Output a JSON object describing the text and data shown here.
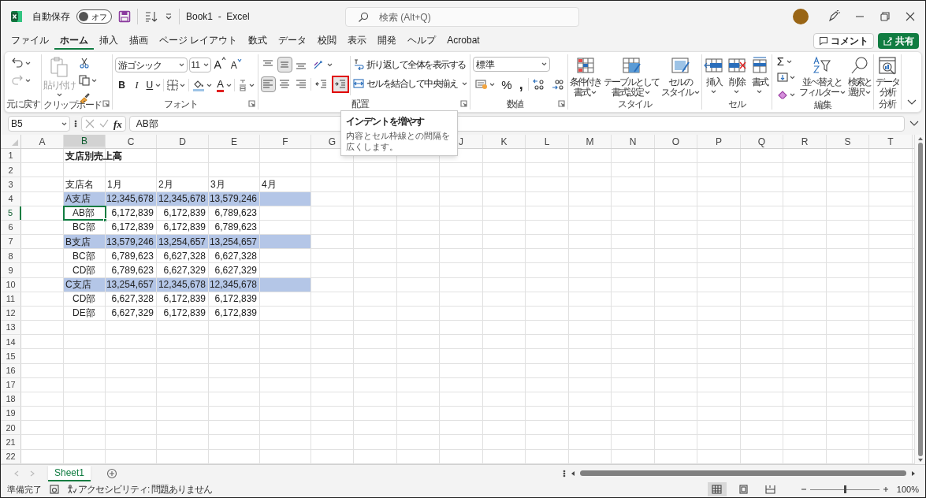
{
  "window": {
    "title": "Book1  -  Excel",
    "autosave_label": "自動保存",
    "autosave_state": "オフ",
    "autosave_on": false,
    "search_placeholder": "検索 (Alt+Q)"
  },
  "menu_tabs": [
    {
      "label": "ファイル",
      "selected": false
    },
    {
      "label": "ホーム",
      "selected": true
    },
    {
      "label": "挿入",
      "selected": false
    },
    {
      "label": "描画",
      "selected": false
    },
    {
      "label": "ページ レイアウト",
      "selected": false
    },
    {
      "label": "数式",
      "selected": false
    },
    {
      "label": "データ",
      "selected": false
    },
    {
      "label": "校閲",
      "selected": false
    },
    {
      "label": "表示",
      "selected": false
    },
    {
      "label": "開発",
      "selected": false
    },
    {
      "label": "ヘルプ",
      "selected": false
    },
    {
      "label": "Acrobat",
      "selected": false
    }
  ],
  "comment_button": "コメント",
  "share_button": "共有",
  "ribbon": {
    "undo": {
      "label": "元に戻す",
      "redo_disabled": true
    },
    "clipboard": {
      "label": "クリップボード",
      "paste": {
        "label": "貼り付け",
        "disabled": true
      }
    },
    "font": {
      "label": "フォント",
      "font_name": "游ゴシック",
      "font_size": "11",
      "grow": "A",
      "shrink": "A",
      "bold": "B",
      "italic": "I",
      "underline": "U",
      "font_color": "A"
    },
    "alignment": {
      "label": "配置",
      "vertical": [
        {
          "kind": "top",
          "selected": false
        },
        {
          "kind": "middle",
          "selected": true
        },
        {
          "kind": "bottom",
          "selected": false
        }
      ],
      "horizontal": [
        {
          "kind": "left",
          "selected": true
        },
        {
          "kind": "center",
          "selected": false
        },
        {
          "kind": "right",
          "selected": false
        }
      ],
      "indent": [
        {
          "kind": "decrease",
          "highlighted": false
        },
        {
          "kind": "increase",
          "highlighted": true
        }
      ],
      "wrap_text": "折り返して全体を表示する",
      "merge": "セルを結合して中央揃え"
    },
    "number": {
      "label": "数値",
      "format": "標準",
      "percent": "%",
      "comma": ","
    },
    "styles": {
      "label": "スタイル",
      "buttons": [
        {
          "kind": "conditional",
          "lines": [
            "条件付き",
            "書式"
          ],
          "dropdown": true
        },
        {
          "kind": "table",
          "lines": [
            "テーブルとして",
            "書式設定"
          ],
          "dropdown": true
        },
        {
          "kind": "cell_style",
          "lines": [
            "セルの",
            "スタイル"
          ],
          "dropdown": true
        }
      ]
    },
    "cells": {
      "label": "セル",
      "buttons": [
        {
          "kind": "insert",
          "lines": [
            "挿入"
          ],
          "dropdown": true
        },
        {
          "kind": "delete",
          "lines": [
            "削除"
          ],
          "dropdown": true
        },
        {
          "kind": "format",
          "lines": [
            "書式"
          ],
          "dropdown": true
        }
      ]
    },
    "editing": {
      "label": "編集",
      "autosum": "Σ",
      "buttons": [
        {
          "kind": "sort",
          "lines": [
            "並べ替えと",
            "フィルター"
          ],
          "dropdown": true
        },
        {
          "kind": "find",
          "lines": [
            "検索と",
            "選択"
          ],
          "dropdown": true
        }
      ]
    },
    "analysis": {
      "label": "分析",
      "buttons": [
        {
          "kind": "analyze",
          "lines": [
            "データ",
            "分析"
          ],
          "dropdown": false
        }
      ]
    }
  },
  "formula_bar": {
    "name_box": "B5",
    "fx": "fx",
    "content": "AB部"
  },
  "tooltip": {
    "title": "インデントを増やす",
    "body": "内容とセル枠線との間隔を広くします。"
  },
  "columns": [
    {
      "label": "A",
      "selected": false
    },
    {
      "label": "B",
      "selected": true
    },
    {
      "label": "C",
      "selected": false
    },
    {
      "label": "D",
      "selected": false
    },
    {
      "label": "E",
      "selected": false
    },
    {
      "label": "F",
      "selected": false
    },
    {
      "label": "G",
      "selected": false
    }
  ],
  "columns_right": [
    {
      "label": "J",
      "selected": false
    },
    {
      "label": "K",
      "selected": false
    },
    {
      "label": "L",
      "selected": false
    },
    {
      "label": "M",
      "selected": false
    },
    {
      "label": "N",
      "selected": false
    },
    {
      "label": "O",
      "selected": false
    },
    {
      "label": "P",
      "selected": false
    },
    {
      "label": "Q",
      "selected": false
    },
    {
      "label": "R",
      "selected": false
    },
    {
      "label": "S",
      "selected": false
    },
    {
      "label": "T",
      "selected": false
    }
  ],
  "rows": [
    {
      "number": "1",
      "selected": false,
      "highlighted": false,
      "cells": [
        {
          "text": "支店別売上高",
          "kind": "title"
        }
      ]
    },
    {
      "number": "2",
      "selected": false,
      "highlighted": false
    },
    {
      "number": "3",
      "selected": false,
      "highlighted": false,
      "cells": [
        {
          "text": "支店名",
          "kind": "label",
          "indented": false
        },
        {
          "text": "1月",
          "kind": "label"
        },
        {
          "text": "2月",
          "kind": "label"
        },
        {
          "text": "3月",
          "kind": "label"
        },
        {
          "text": "4月",
          "kind": "label"
        }
      ]
    },
    {
      "number": "4",
      "selected": false,
      "highlighted": true,
      "cells": [
        {
          "text": "A支店",
          "kind": "label",
          "indented": false
        },
        {
          "text": "12,345,678",
          "kind": "number"
        },
        {
          "text": "12,345,678",
          "kind": "number"
        },
        {
          "text": "13,579,246",
          "kind": "number"
        }
      ]
    },
    {
      "number": "5",
      "selected": true,
      "highlighted": false,
      "cells": [
        {
          "text": "AB部",
          "kind": "label",
          "indented": true
        },
        {
          "text": "6,172,839",
          "kind": "number"
        },
        {
          "text": "6,172,839",
          "kind": "number"
        },
        {
          "text": "6,789,623",
          "kind": "number"
        }
      ]
    },
    {
      "number": "6",
      "selected": false,
      "highlighted": false,
      "cells": [
        {
          "text": "BC部",
          "kind": "label",
          "indented": true
        },
        {
          "text": "6,172,839",
          "kind": "number"
        },
        {
          "text": "6,172,839",
          "kind": "number"
        },
        {
          "text": "6,789,623",
          "kind": "number"
        }
      ]
    },
    {
      "number": "7",
      "selected": false,
      "highlighted": true,
      "cells": [
        {
          "text": "B支店",
          "kind": "label",
          "indented": false
        },
        {
          "text": "13,579,246",
          "kind": "number"
        },
        {
          "text": "13,254,657",
          "kind": "number"
        },
        {
          "text": "13,254,657",
          "kind": "number"
        }
      ]
    },
    {
      "number": "8",
      "selected": false,
      "highlighted": false,
      "cells": [
        {
          "text": "BC部",
          "kind": "label",
          "indented": true
        },
        {
          "text": "6,789,623",
          "kind": "number"
        },
        {
          "text": "6,627,328",
          "kind": "number"
        },
        {
          "text": "6,627,328",
          "kind": "number"
        }
      ]
    },
    {
      "number": "9",
      "selected": false,
      "highlighted": false,
      "cells": [
        {
          "text": "CD部",
          "kind": "label",
          "indented": true
        },
        {
          "text": "6,789,623",
          "kind": "number"
        },
        {
          "text": "6,627,329",
          "kind": "number"
        },
        {
          "text": "6,627,329",
          "kind": "number"
        }
      ]
    },
    {
      "number": "10",
      "selected": false,
      "highlighted": true,
      "cells": [
        {
          "text": "C支店",
          "kind": "label",
          "indented": false
        },
        {
          "text": "13,254,657",
          "kind": "number"
        },
        {
          "text": "12,345,678",
          "kind": "number"
        },
        {
          "text": "12,345,678",
          "kind": "number"
        }
      ]
    },
    {
      "number": "11",
      "selected": false,
      "highlighted": false,
      "cells": [
        {
          "text": "CD部",
          "kind": "label",
          "indented": true
        },
        {
          "text": "6,627,328",
          "kind": "number"
        },
        {
          "text": "6,172,839",
          "kind": "number"
        },
        {
          "text": "6,172,839",
          "kind": "number"
        }
      ]
    },
    {
      "number": "12",
      "selected": false,
      "highlighted": false,
      "cells": [
        {
          "text": "DE部",
          "kind": "label",
          "indented": true
        },
        {
          "text": "6,627,329",
          "kind": "number"
        },
        {
          "text": "6,172,839",
          "kind": "number"
        },
        {
          "text": "6,172,839",
          "kind": "number"
        }
      ]
    },
    {
      "number": "13",
      "selected": false,
      "highlighted": false
    },
    {
      "number": "14",
      "selected": false,
      "highlighted": false
    },
    {
      "number": "15",
      "selected": false,
      "highlighted": false
    },
    {
      "number": "16",
      "selected": false,
      "highlighted": false
    },
    {
      "number": "17",
      "selected": false,
      "highlighted": false
    },
    {
      "number": "18",
      "selected": false,
      "highlighted": false
    },
    {
      "number": "19",
      "selected": false,
      "highlighted": false
    },
    {
      "number": "20",
      "selected": false,
      "highlighted": false
    },
    {
      "number": "21",
      "selected": false,
      "highlighted": false
    },
    {
      "number": "22",
      "selected": false,
      "highlighted": false
    }
  ],
  "sheet_tabs": [
    {
      "label": "Sheet1",
      "selected": true
    }
  ],
  "status_bar": {
    "ready": "準備完了",
    "accessibility": "アクセシビリティ: 問題ありません",
    "views": [
      {
        "kind": "normal",
        "selected": true
      },
      {
        "kind": "page_layout",
        "selected": false
      },
      {
        "kind": "page_break",
        "selected": false
      }
    ],
    "zoom": {
      "level": 0.5,
      "reading": "100%"
    }
  }
}
